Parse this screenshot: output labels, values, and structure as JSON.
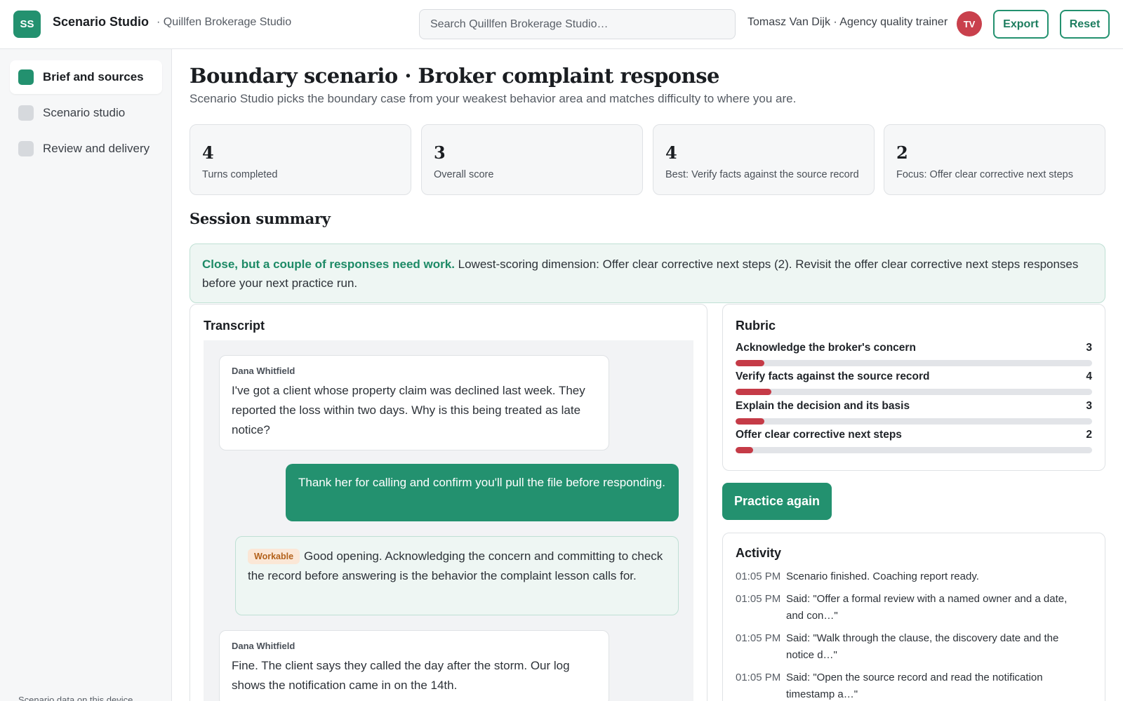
{
  "app": {
    "logo_initials": "SS",
    "title": "Scenario Studio",
    "workspace": "· Quillfen Brokerage Studio"
  },
  "search": {
    "placeholder": "Search Quillfen Brokerage Studio…"
  },
  "user": {
    "label": "Tomasz Van Dijk · Agency quality trainer",
    "initials": "TV"
  },
  "toolbar": {
    "export_label": "Export",
    "reset_label": "Reset"
  },
  "sidebar": {
    "items": [
      {
        "label": "Brief and sources",
        "active": true
      },
      {
        "label": "Scenario studio",
        "active": false
      },
      {
        "label": "Review and delivery",
        "active": false
      }
    ],
    "footer": "Scenario data on this device"
  },
  "page": {
    "title": "Boundary scenario · Broker complaint response",
    "subtitle": "Scenario Studio picks the boundary case from your weakest behavior area and matches difficulty to where you are."
  },
  "stats": [
    {
      "value": "4",
      "label": "Turns completed"
    },
    {
      "value": "3",
      "label": "Overall score"
    },
    {
      "value": "4",
      "label": "Best: Verify facts against the source record"
    },
    {
      "value": "2",
      "label": "Focus: Offer clear corrective next steps"
    }
  ],
  "summary": {
    "heading": "Session summary",
    "lead": "Close, but a couple of responses need work.",
    "body": " Lowest-scoring dimension: Offer clear corrective next steps (2). Revisit the offer clear corrective next steps responses before your next practice run."
  },
  "transcript": {
    "title": "Transcript",
    "messages": [
      {
        "author": "Dana Whitfield",
        "text": "I've got a client whose property claim was declined last week. They reported the loss within two days. Why is this being treated as late notice?"
      },
      {
        "author": "Dana Whitfield",
        "text": "Fine. The client says they called the day after the storm. Our log shows the notification came in on the 14th."
      }
    ],
    "reply": "Thank her for calling and confirm you'll pull the file before responding.",
    "feedback": {
      "badge": "Workable",
      "text": "Good opening. Acknowledging the concern and committing to check the record before answering is the behavior the complaint lesson calls for."
    }
  },
  "rubric": {
    "title": "Rubric",
    "max_score": 5,
    "items": [
      {
        "name": "Acknowledge the broker's concern",
        "score": 3,
        "fill": 0.08
      },
      {
        "name": "Verify facts against the source record",
        "score": 4,
        "fill": 0.1
      },
      {
        "name": "Explain the decision and its basis",
        "score": 3,
        "fill": 0.08
      },
      {
        "name": "Offer clear corrective next steps",
        "score": 2,
        "fill": 0.05
      }
    ]
  },
  "practice_label": "Practice again",
  "activity": {
    "title": "Activity",
    "items": [
      {
        "time": "01:05 PM",
        "text": "Scenario finished. Coaching report ready."
      },
      {
        "time": "01:05 PM",
        "text": "Said: \"Offer a formal review with a named owner and a date, and con…\""
      },
      {
        "time": "01:05 PM",
        "text": "Said: \"Walk through the clause, the discovery date and the notice d…\""
      },
      {
        "time": "01:05 PM",
        "text": "Said: \"Open the source record and read the notification timestamp a…\""
      }
    ]
  },
  "colors": {
    "accent": "#23916f",
    "danger": "#c53b47",
    "avatar": "#c9404c"
  }
}
